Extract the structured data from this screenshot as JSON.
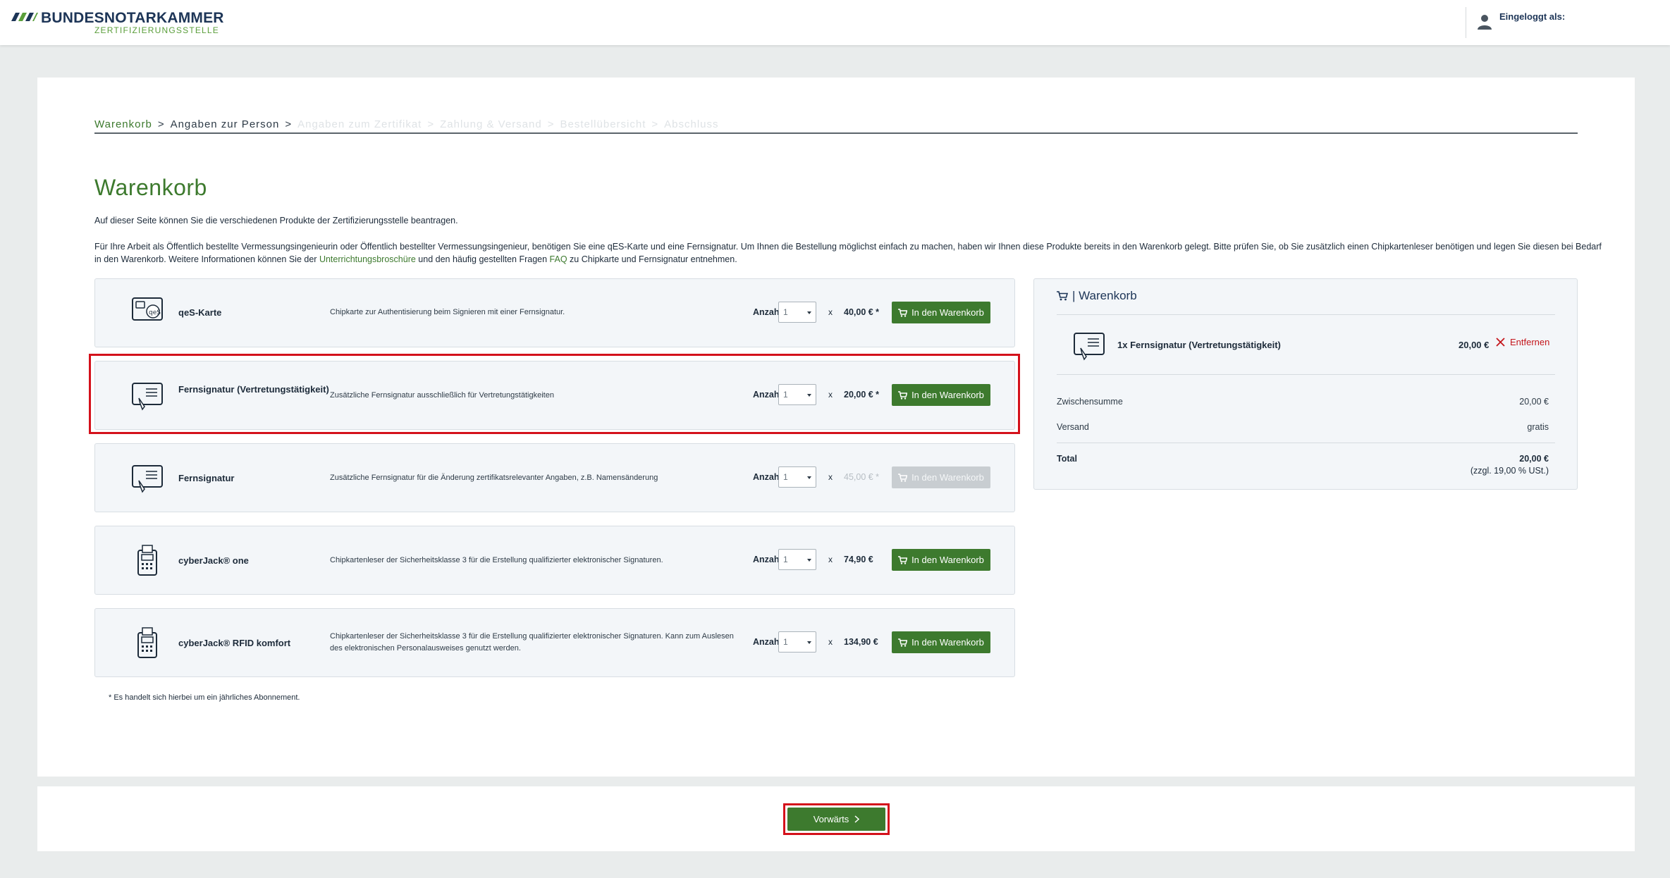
{
  "header": {
    "logo_title": "BUNDESNOTARKAMMER",
    "logo_subtitle": "ZERTIFIZIERUNGSSTELLE",
    "user_label": "Eingeloggt als:"
  },
  "breadcrumb": [
    {
      "label": "Warenkorb",
      "state": "active"
    },
    {
      "label": "Angaben zur Person",
      "state": "current"
    },
    {
      "label": "Angaben zum Zertifikat",
      "state": "disabled"
    },
    {
      "label": "Zahlung & Versand",
      "state": "disabled"
    },
    {
      "label": "Bestellübersicht",
      "state": "disabled"
    },
    {
      "label": "Abschluss",
      "state": "disabled"
    }
  ],
  "page": {
    "title": "Warenkorb",
    "intro": "Auf dieser Seite können Sie die verschiedenen Produkte der Zertifizierungsstelle beantragen.",
    "intro2_part1": "Für Ihre Arbeit als Öffentlich bestellte Vermessungsingenieurin oder Öffentlich bestellter Vermessungsingenieur, benötigen Sie eine qES-Karte und eine Fernsignatur. Um Ihnen die Bestellung möglichst einfach zu machen, haben wir Ihnen diese Produkte bereits in den Warenkorb gelegt. Bitte prüfen Sie, ob Sie zusätzlich einen Chipkartenleser benötigen und legen Sie diesen bei Bedarf in den Warenkorb. Weitere Informationen können Sie der ",
    "intro2_link1": "Unterrichtungsbroschüre",
    "intro2_part2": " und den häufig gestellten Fragen ",
    "intro2_link2": "FAQ",
    "intro2_part3": " zu Chipkarte und Fernsignatur entnehmen.",
    "footnote": "* Es handelt sich hierbei um ein jährliches Abonnement."
  },
  "products": [
    {
      "name": "qeS-Karte",
      "description": "Chipkarte zur Authentisierung beim Signieren mit einer Fernsignatur.",
      "qty_label": "Anzahl",
      "qty": "1",
      "times": "x",
      "price": "40,00 € *",
      "button": "In den Warenkorb",
      "enabled": true,
      "icon": "card-icon"
    },
    {
      "name": "Fernsignatur (Vertretungstätigkeit)",
      "description": "Zusätzliche Fernsignatur ausschließlich für Vertretungstätigkeiten",
      "qty_label": "Anzahl",
      "qty": "1",
      "times": "x",
      "price": "20,00 € *",
      "button": "In den Warenkorb",
      "enabled": true,
      "icon": "signature-icon"
    },
    {
      "name": "Fernsignatur",
      "description": "Zusätzliche Fernsignatur für die Änderung zertifikatsrelevanter Angaben, z.B. Namensänderung",
      "qty_label": "Anzahl",
      "qty": "1",
      "times": "x",
      "price": "45,00 € *",
      "button": "In den Warenkorb",
      "enabled": false,
      "icon": "signature-icon"
    },
    {
      "name": "cyberJack® one",
      "description": "Chipkartenleser der Sicherheitsklasse 3 für die Erstellung qualifizierter elektronischer Signaturen.",
      "qty_label": "Anzahl",
      "qty": "1",
      "times": "x",
      "price": "74,90 €",
      "button": "In den Warenkorb",
      "enabled": true,
      "icon": "card-reader-icon"
    },
    {
      "name": "cyberJack® RFID komfort",
      "description": "Chipkartenleser der Sicherheitsklasse 3 für die Erstellung qualifizierter elektronischer Signaturen. Kann zum Auslesen des elektronischen Personalausweises genutzt werden.",
      "qty_label": "Anzahl",
      "qty": "1",
      "times": "x",
      "price": "134,90 €",
      "button": "In den Warenkorb",
      "enabled": true,
      "icon": "card-reader-icon"
    }
  ],
  "summary": {
    "title": "| Warenkorb",
    "item_name": "1x Fernsignatur (Vertretungstätigkeit)",
    "item_price": "20,00 €",
    "remove_label": "Entfernen",
    "subtotal_label": "Zwischensumme",
    "subtotal_value": "20,00 €",
    "shipping_label": "Versand",
    "shipping_value": "gratis",
    "total_label": "Total",
    "total_value": "20,00 €",
    "tax_note": "(zzgl. 19,00 % USt.)"
  },
  "footer": {
    "next_label": "Vorwärts"
  },
  "colors": {
    "accent_green": "#3d7a2e",
    "navy": "#1d3557",
    "highlight_red": "#d4111b",
    "remove_red": "#c4161c"
  }
}
